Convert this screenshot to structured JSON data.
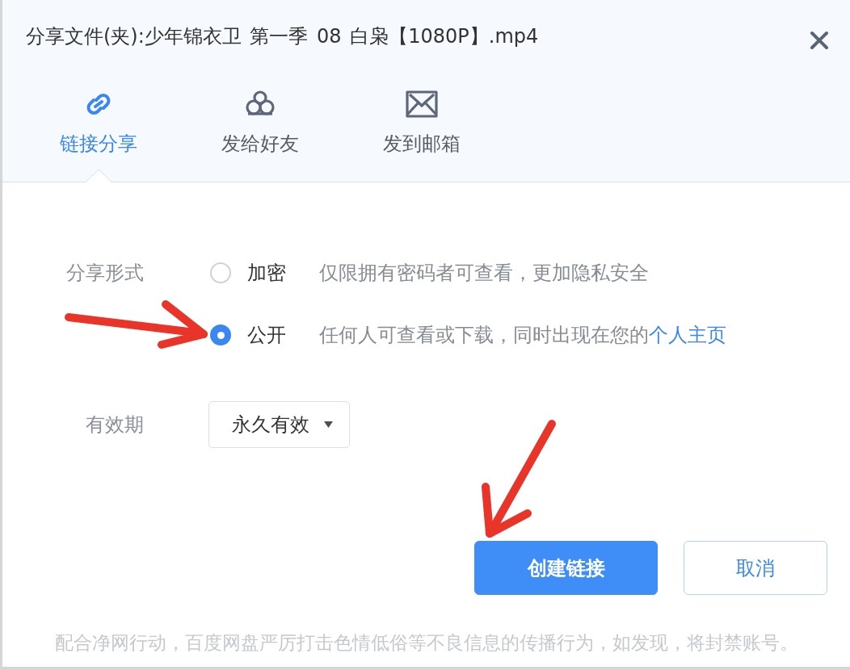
{
  "dialog": {
    "title": "分享文件(夹):少年锦衣卫 第一季 08 白枭【1080P】.mp4"
  },
  "tabs": [
    {
      "label": "链接分享",
      "selected": true,
      "kind": "link"
    },
    {
      "label": "发给好友",
      "selected": false,
      "kind": "friends"
    },
    {
      "label": "发到邮箱",
      "selected": false,
      "kind": "mail"
    }
  ],
  "share_form": {
    "label": "分享形式",
    "options": [
      {
        "label": "加密",
        "description": "仅限拥有密码者可查看，更加隐私安全",
        "selected": false
      },
      {
        "label": "公开",
        "description": "任何人可查看或下载，同时出现在您的",
        "link": "个人主页",
        "selected": true
      }
    ]
  },
  "validity": {
    "label": "有效期",
    "value": "永久有效"
  },
  "buttons": [
    {
      "label": "创建链接",
      "kind": "primary"
    },
    {
      "label": "取消",
      "kind": "secondary"
    }
  ],
  "notice": "配合净网行动，百度网盘严厉打击色情低俗等不良信息的传播行为，如发现，将封禁账号。"
}
